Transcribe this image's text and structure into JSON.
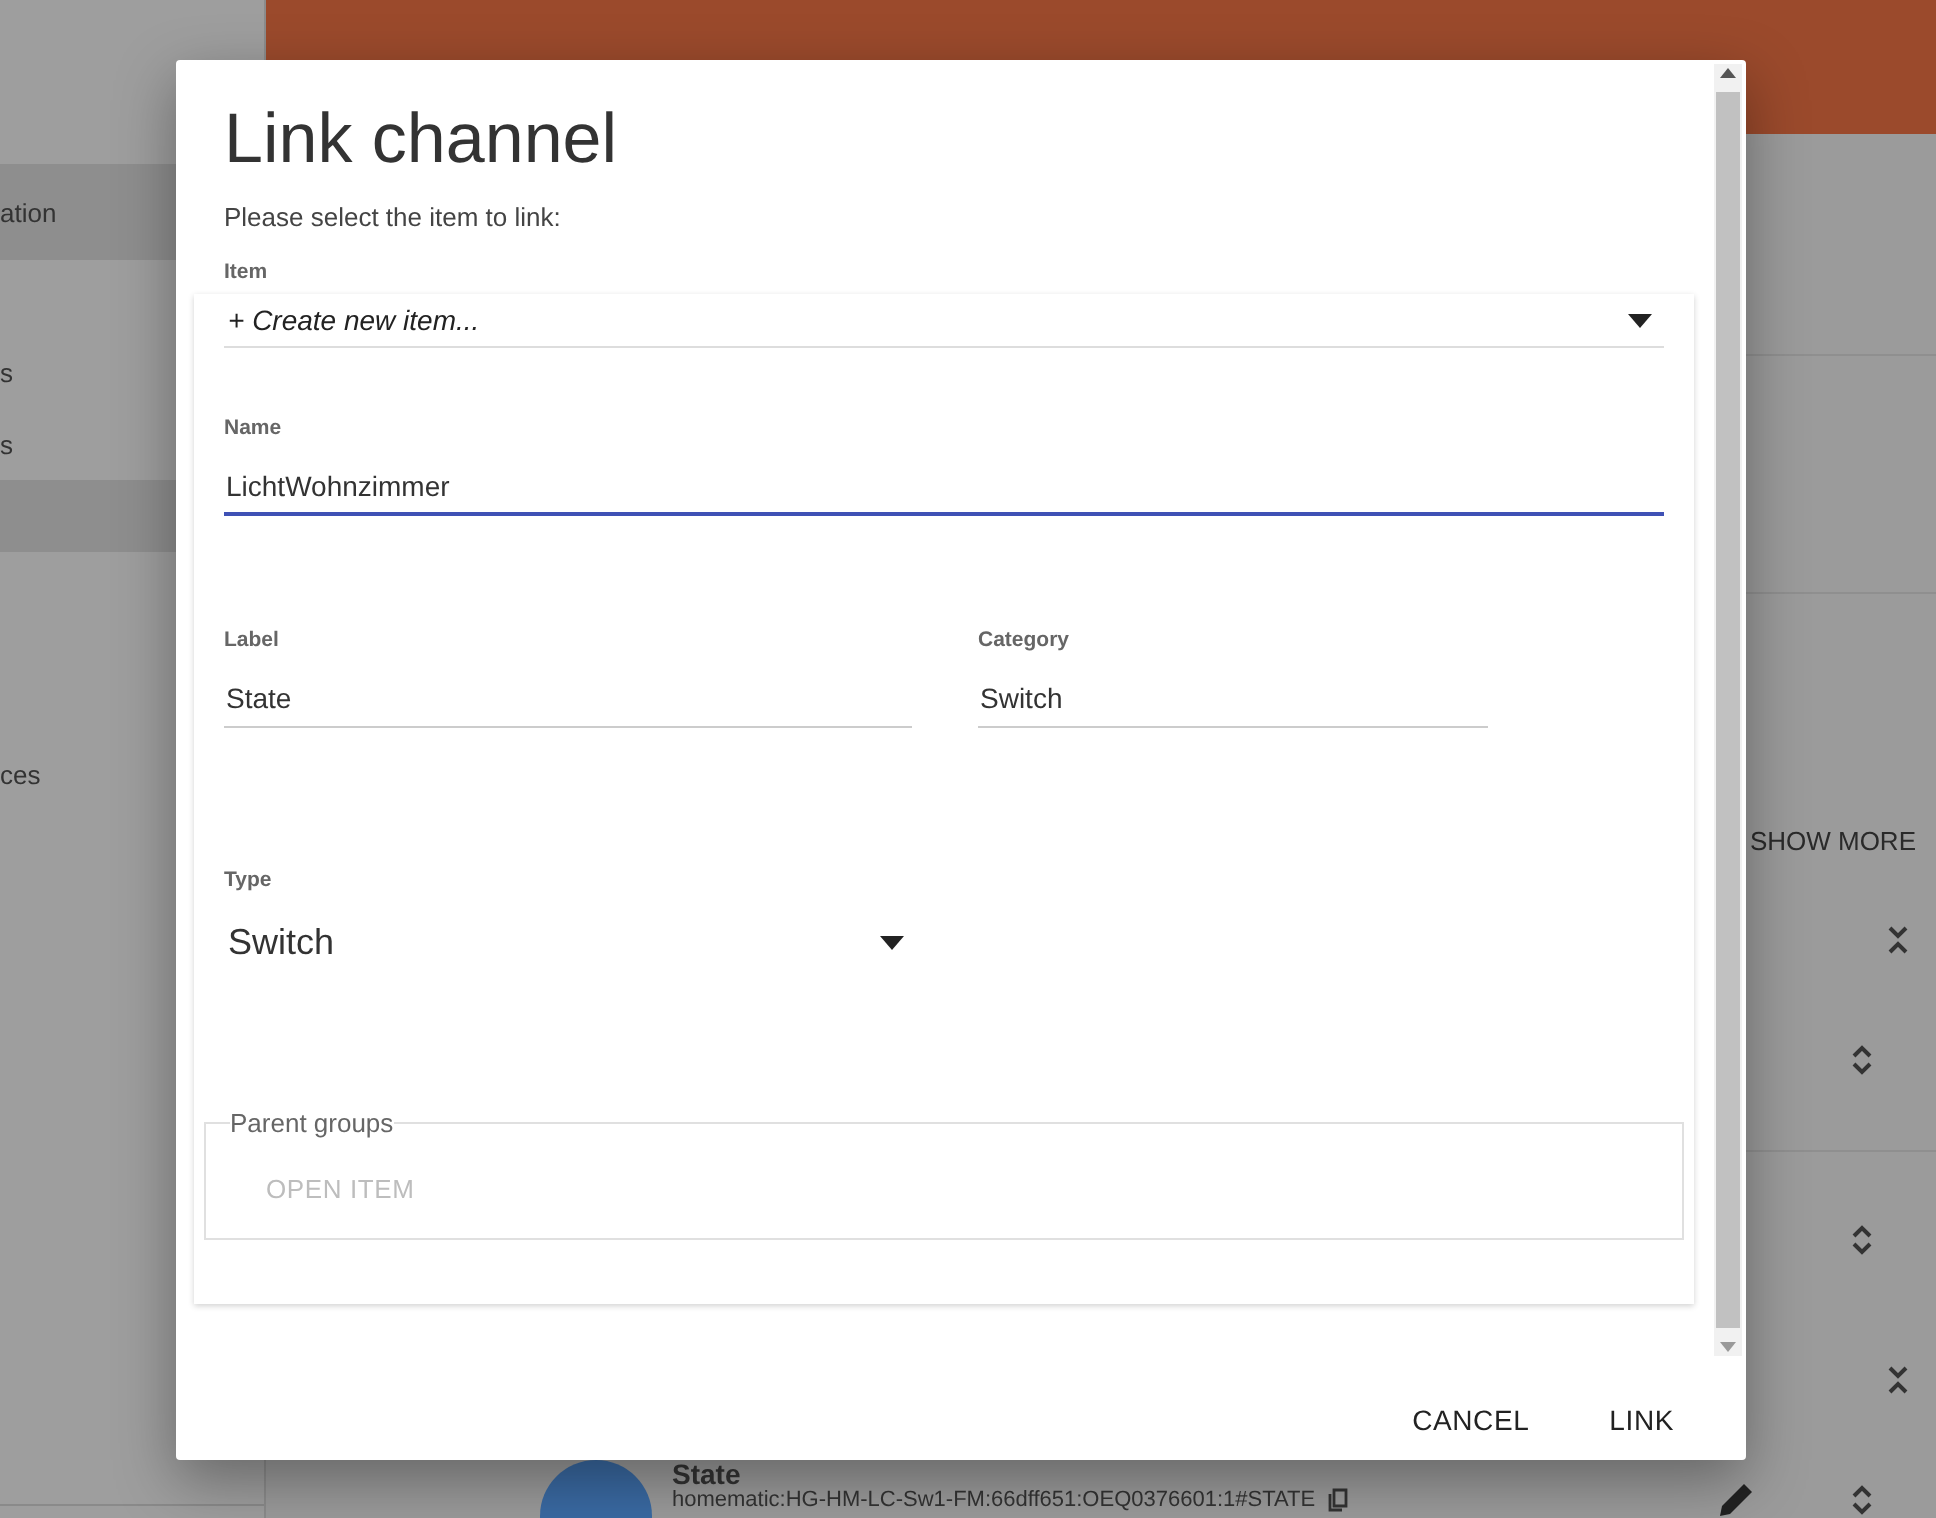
{
  "sidebar": {
    "items": [
      {
        "label": "ation",
        "selected": true
      },
      {
        "label": "s",
        "selected": false
      },
      {
        "label": "s",
        "selected": false
      },
      {
        "selected": true
      },
      {
        "label": "ces",
        "selected": false
      }
    ]
  },
  "main": {
    "show_more": "SHOW MORE",
    "toggles": [
      {
        "kind": "collapse"
      },
      {
        "kind": "expand"
      },
      {
        "kind": "expand"
      },
      {
        "kind": "collapse"
      },
      {
        "kind": "expand"
      }
    ],
    "list_item": {
      "title": "State",
      "subtitle": "homematic:HG-HM-LC-Sw1-FM:66dff651:OEQ0376601:1#STATE"
    }
  },
  "dialog": {
    "title": "Link channel",
    "subtitle": "Please select the item to link:",
    "item": {
      "label": "Item",
      "value": "+ Create new item..."
    },
    "name": {
      "label": "Name",
      "value": "LichtWohnzimmer",
      "focused": true
    },
    "label": {
      "label": "Label",
      "value": "State"
    },
    "category": {
      "label": "Category",
      "value": "Switch"
    },
    "type": {
      "label": "Type",
      "value": "Switch"
    },
    "parent_groups": {
      "legend": "Parent groups",
      "button": "OPEN ITEM",
      "disabled": true
    },
    "actions": [
      "CANCEL",
      "LINK"
    ]
  }
}
